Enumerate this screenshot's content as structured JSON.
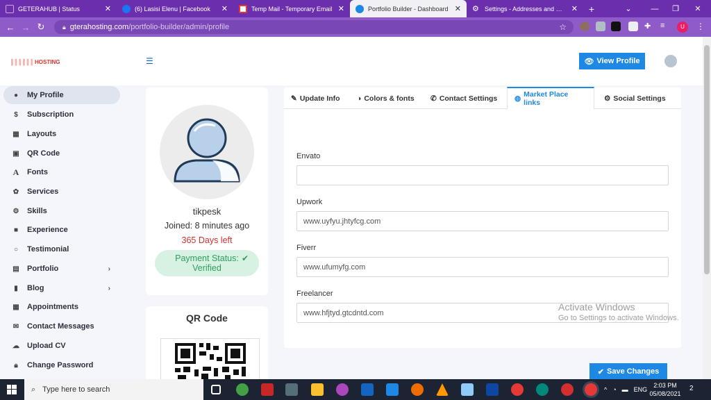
{
  "browser": {
    "tabs": [
      {
        "title": "GETERAHUB | Status",
        "color": "#6b2fae",
        "active": false
      },
      {
        "title": "(6) Lasisi Elenu | Facebook",
        "color": "#1877f2",
        "active": false
      },
      {
        "title": "Temp Mail - Temporary Email",
        "color": "#e53935",
        "active": false
      },
      {
        "title": "Portfolio Builder - Dashboard",
        "color": "#1e88e5",
        "active": true
      },
      {
        "title": "Settings - Addresses and more",
        "color": "#5f6368",
        "active": false
      }
    ],
    "url_host": "gterahosting.com",
    "url_path": "/portfolio-builder/admin/profile",
    "profile_initial": "U"
  },
  "header": {
    "logo_text": "HOSTING",
    "view_profile_label": "View Profile"
  },
  "sidebar": {
    "items": [
      {
        "label": "My Profile",
        "icon": "user-icon"
      },
      {
        "label": "Subscription",
        "icon": "dollar-icon"
      },
      {
        "label": "Layouts",
        "icon": "layout-icon"
      },
      {
        "label": "QR Code",
        "icon": "qrcode-icon"
      },
      {
        "label": "Fonts",
        "icon": "font-icon"
      },
      {
        "label": "Services",
        "icon": "services-icon"
      },
      {
        "label": "Skills",
        "icon": "cogs-icon"
      },
      {
        "label": "Experience",
        "icon": "briefcase-icon"
      },
      {
        "label": "Testimonial",
        "icon": "comment-icon"
      },
      {
        "label": "Portfolio",
        "icon": "portfolio-icon"
      },
      {
        "label": "Blog",
        "icon": "blog-icon"
      },
      {
        "label": "Appointments",
        "icon": "calendar-icon"
      },
      {
        "label": "Contact Messages",
        "icon": "envelope-icon"
      },
      {
        "label": "Upload CV",
        "icon": "upload-icon"
      },
      {
        "label": "Change Password",
        "icon": "lock-icon"
      }
    ]
  },
  "profile": {
    "username": "tikpesk",
    "joined": "Joined: 8 minutes ago",
    "days_left": "365 Days left",
    "payment_line1": "Payment Status:",
    "payment_line2": "Verified",
    "qr_title": "QR Code"
  },
  "form": {
    "tabs": [
      {
        "label": "Update Info",
        "icon": "edit-icon"
      },
      {
        "label": "Colors & fonts",
        "icon": "palette-icon"
      },
      {
        "label": "Contact Settings",
        "icon": "phone-icon"
      },
      {
        "label": "Market Place links",
        "icon": "globe-icon"
      },
      {
        "label": "Social Settings",
        "icon": "gear-icon"
      }
    ],
    "fields": [
      {
        "label": "Envato",
        "value": ""
      },
      {
        "label": "Upwork",
        "value": "www.uyfyu.jhtyfcg.com"
      },
      {
        "label": "Fiverr",
        "value": "www.ufumyfg.com"
      },
      {
        "label": "Freelancer",
        "value": "www.hfjtyd.gtcdntd.com"
      }
    ],
    "save_label": "Save Changes"
  },
  "watermark": {
    "line1": "Activate Windows",
    "line2": "Go to Settings to activate Windows."
  },
  "taskbar": {
    "search_placeholder": "Type here to search",
    "language": "ENG",
    "time": "2:03 PM",
    "date": "05/08/2021",
    "notifications": "2"
  }
}
